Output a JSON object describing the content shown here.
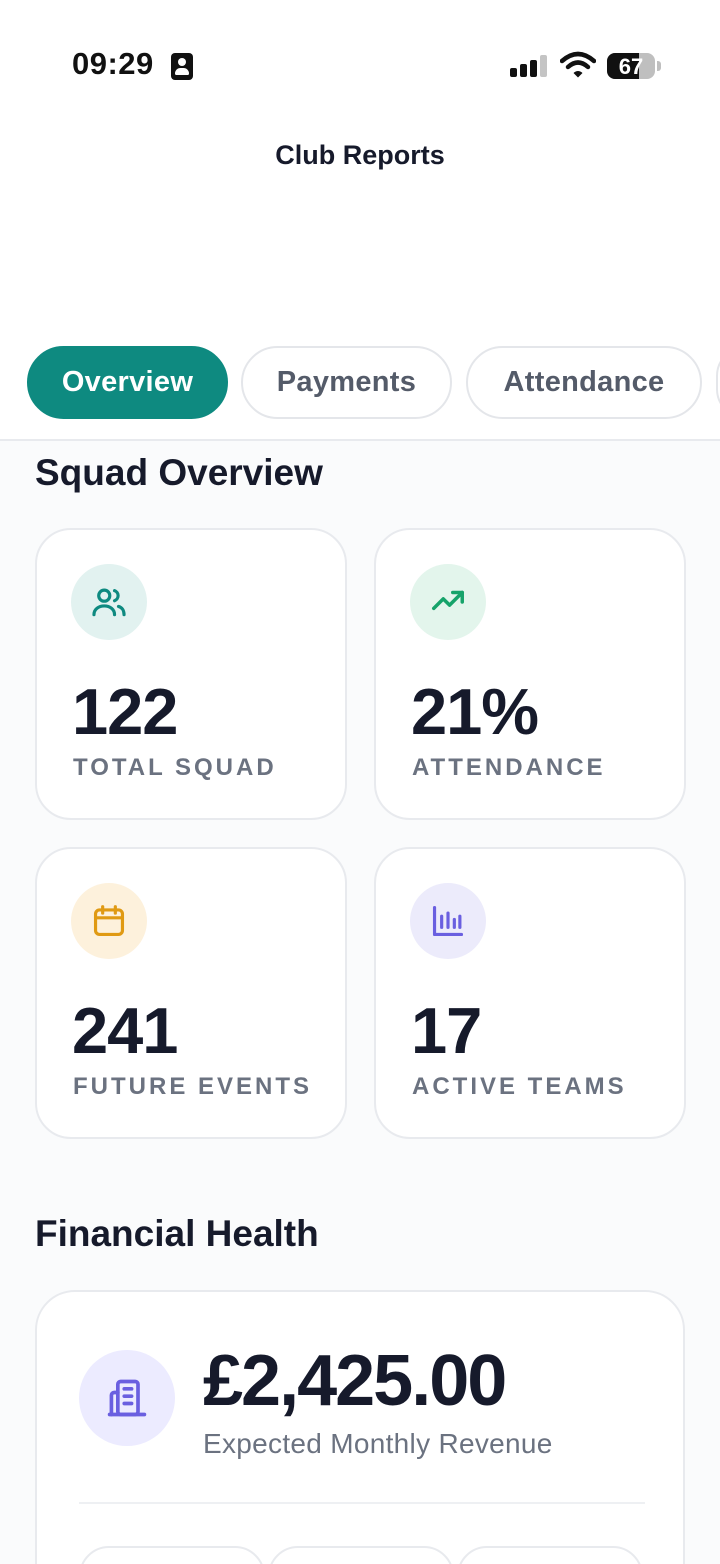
{
  "status_bar": {
    "time": "09:29",
    "battery": "67",
    "battery_fraction": 0.67
  },
  "header": {
    "title": "Club Reports"
  },
  "tabs": [
    {
      "label": "Overview",
      "active": true
    },
    {
      "label": "Payments",
      "active": false
    },
    {
      "label": "Attendance",
      "active": false
    }
  ],
  "squad_overview": {
    "title": "Squad Overview",
    "cards": [
      {
        "value": "122",
        "label": "TOTAL SQUAD",
        "icon": "users-icon",
        "icon_color": "#0e8a80",
        "icon_bg": "#e2f2f0"
      },
      {
        "value": "21%",
        "label": "ATTENDANCE",
        "icon": "trending-up-icon",
        "icon_color": "#16a36a",
        "icon_bg": "#e3f5ec"
      },
      {
        "value": "241",
        "label": "FUTURE EVENTS",
        "icon": "calendar-icon",
        "icon_color": "#e09a13",
        "icon_bg": "#fdf1dc"
      },
      {
        "value": "17",
        "label": "ACTIVE TEAMS",
        "icon": "bar-chart-icon",
        "icon_color": "#6a5fe0",
        "icon_bg": "#ecebfb"
      }
    ]
  },
  "financial_health": {
    "title": "Financial Health",
    "revenue_value": "£2,425.00",
    "revenue_label": "Expected Monthly Revenue",
    "icon": "building-icon",
    "icon_color": "#6a5fe0"
  }
}
